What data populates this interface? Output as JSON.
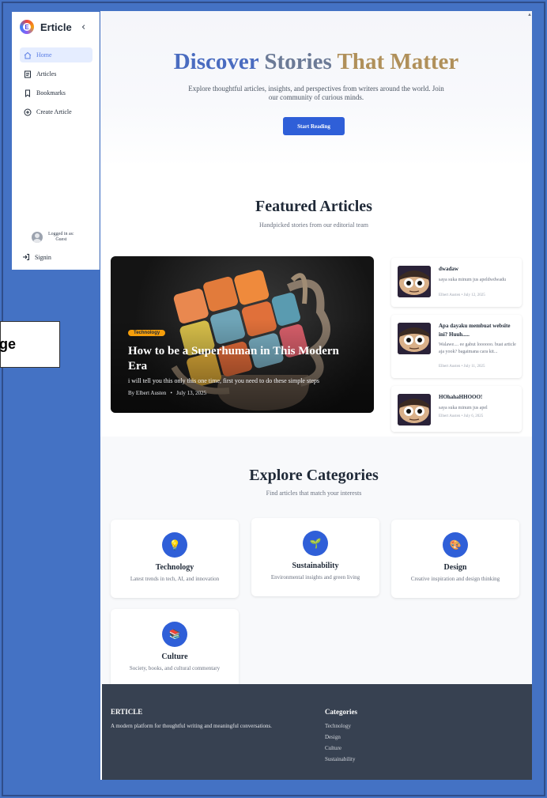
{
  "sidebar": {
    "brand": "Erticle",
    "brand_initial": "E",
    "items": [
      {
        "label": "Home",
        "icon": "home-icon",
        "active": true
      },
      {
        "label": "Articles",
        "icon": "document-icon"
      },
      {
        "label": "Bookmarks",
        "icon": "bookmark-icon"
      },
      {
        "label": "Create Article",
        "icon": "plus-circle-icon"
      }
    ],
    "user_line1": "Logged in as:",
    "user_line2": "Guest",
    "signin": "Signin"
  },
  "callout_text": "ge",
  "hero": {
    "title_part1": "Discover",
    "title_part2": "Stories",
    "title_part3": "That Matter",
    "subtitle": "Explore thoughtful articles, insights, and perspectives from writers around the world. Join our community of curious minds.",
    "button": "Start Reading"
  },
  "featured": {
    "title": "Featured Articles",
    "subtitle": "Handpicked stories from our editorial team",
    "main": {
      "tag": "Technology",
      "title": "How to be a Superhuman in This Modern Era",
      "desc": "i will tell you this only this one time, first you need to do these simple steps",
      "author": "By Elbert Austen",
      "date": "July 13, 2025"
    },
    "side": [
      {
        "title": "dwadaw",
        "desc": "saya suka minum jus apeldwdwadu",
        "meta": "Elbert Austen • July 12, 2025"
      },
      {
        "title": "Apa dayaku membuat website ini? Huuh.....",
        "desc": "Walawe.... ee gabut loooooo. buat article aja yook? bagaimana cara kit...",
        "meta": "Elbert Austen • July 11, 2025"
      },
      {
        "title": "HOhahaHHOOO!",
        "desc": "saya suka minum jus apel",
        "meta": "Elbert Austen • July 6, 2025"
      }
    ]
  },
  "categories": {
    "title": "Explore Categories",
    "subtitle": "Find articles that match your interests",
    "items": [
      {
        "name": "Technology",
        "desc": "Latest trends in tech, AI, and innovation",
        "icon": "💡"
      },
      {
        "name": "Sustainability",
        "desc": "Environmental insights and green living",
        "icon": "🌱"
      },
      {
        "name": "Design",
        "desc": "Creative inspiration and design thinking",
        "icon": "🎨"
      },
      {
        "name": "Culture",
        "desc": "Society, books, and cultural commentary",
        "icon": "📚"
      }
    ]
  },
  "footer": {
    "brand": "ERTICLE",
    "tagline": "A modern platform for thoughtful writing and meaningful conversations.",
    "categories_title": "Categories",
    "links": [
      "Technology",
      "Design",
      "Culture",
      "Sustainability"
    ]
  }
}
